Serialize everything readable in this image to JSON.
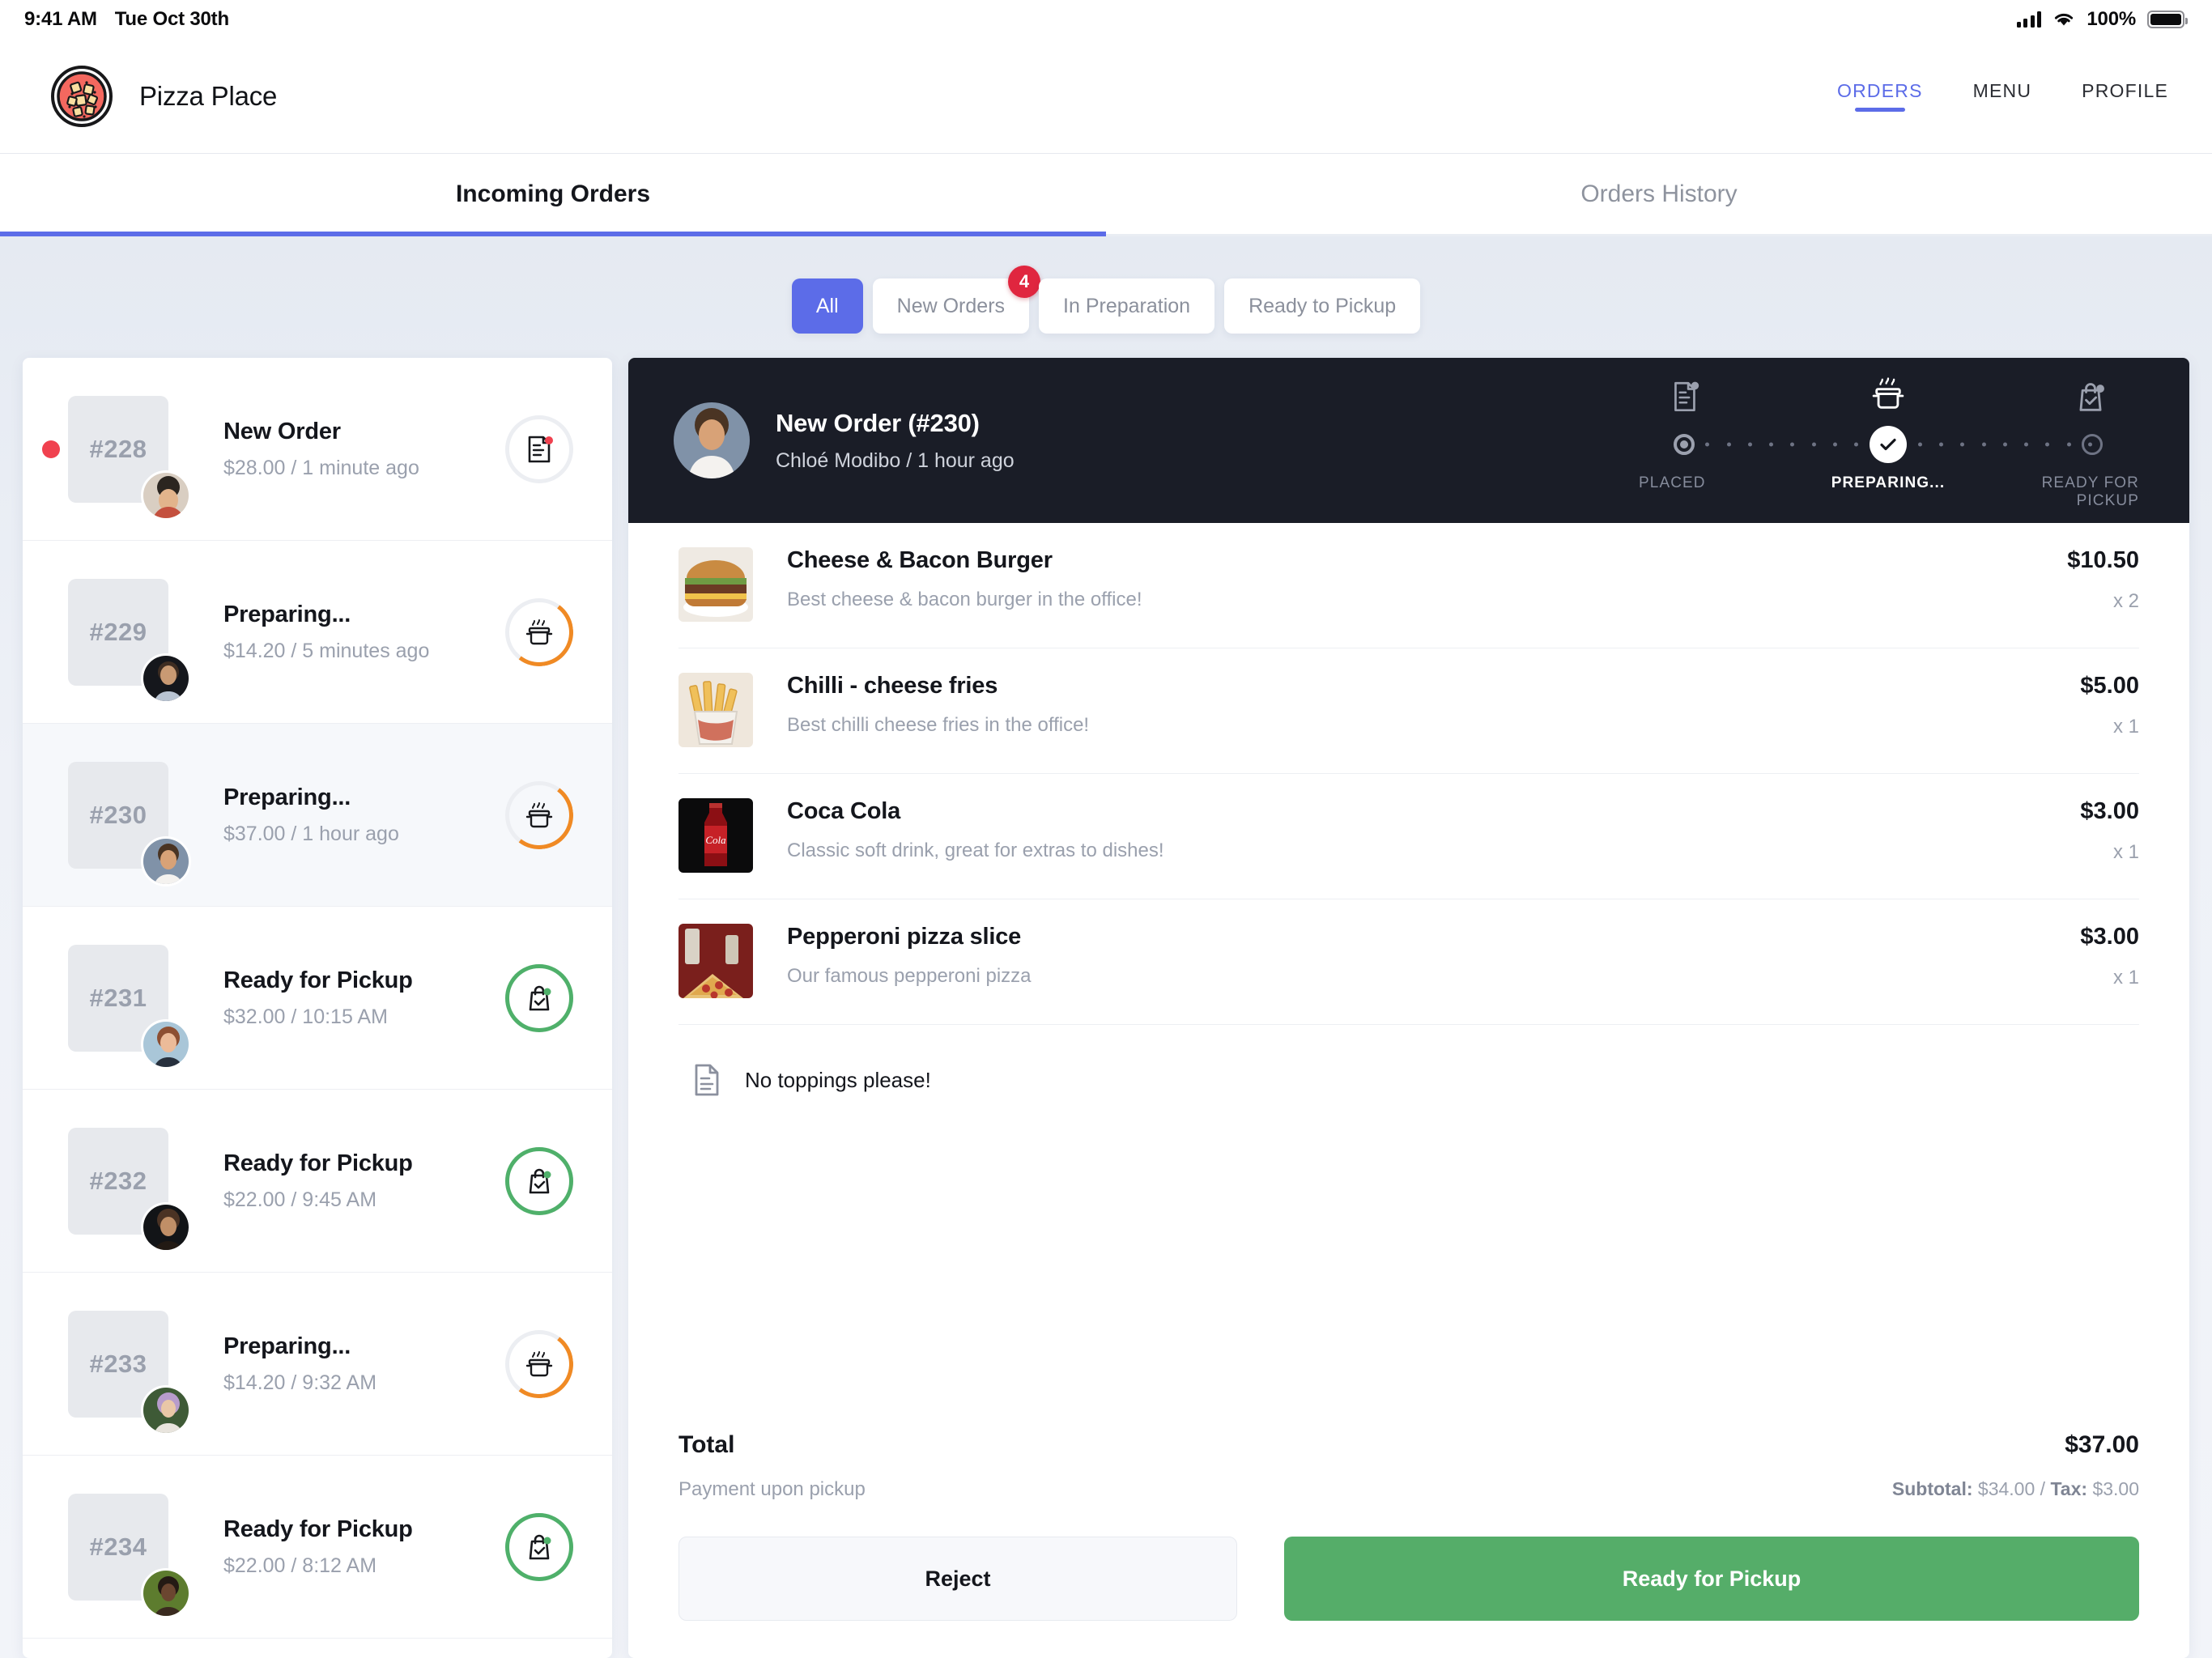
{
  "statusbar": {
    "time": "9:41 AM",
    "date": "Tue Oct 30th",
    "battery": "100%"
  },
  "brand": {
    "name": "Pizza Place"
  },
  "topnav": [
    {
      "label": "ORDERS",
      "active": true
    },
    {
      "label": "MENU",
      "active": false
    },
    {
      "label": "PROFILE",
      "active": false
    }
  ],
  "tabs": [
    {
      "label": "Incoming Orders",
      "active": true
    },
    {
      "label": "Orders History",
      "active": false
    }
  ],
  "filters": [
    {
      "label": "All",
      "active": true,
      "badge": ""
    },
    {
      "label": "New Orders",
      "active": false,
      "badge": "4"
    },
    {
      "label": "In Preparation",
      "active": false,
      "badge": ""
    },
    {
      "label": "Ready to Pickup",
      "active": false,
      "badge": ""
    }
  ],
  "orders": [
    {
      "id": "#228",
      "title": "New Order",
      "sub": "$28.00 / 1 minute ago",
      "state": "new",
      "selected": false,
      "dot": true
    },
    {
      "id": "#229",
      "title": "Preparing...",
      "sub": "$14.20 / 5 minutes ago",
      "state": "preparing",
      "selected": false,
      "dot": false
    },
    {
      "id": "#230",
      "title": "Preparing...",
      "sub": "$37.00 / 1 hour ago",
      "state": "preparing",
      "selected": true,
      "dot": false
    },
    {
      "id": "#231",
      "title": "Ready for Pickup",
      "sub": "$32.00 / 10:15 AM",
      "state": "ready",
      "selected": false,
      "dot": false
    },
    {
      "id": "#232",
      "title": "Ready for Pickup",
      "sub": "$22.00 / 9:45 AM",
      "state": "ready",
      "selected": false,
      "dot": false
    },
    {
      "id": "#233",
      "title": "Preparing...",
      "sub": "$14.20 / 9:32 AM",
      "state": "preparing",
      "selected": false,
      "dot": false
    },
    {
      "id": "#234",
      "title": "Ready for Pickup",
      "sub": "$22.00 / 8:12 AM",
      "state": "ready",
      "selected": false,
      "dot": false
    }
  ],
  "detail": {
    "title": "New Order (#230)",
    "subtitle": "Chloé Modibo / 1 hour ago",
    "steps": [
      {
        "label": "PLACED",
        "state": "done"
      },
      {
        "label": "PREPARING...",
        "state": "current"
      },
      {
        "label": "READY FOR PICKUP",
        "state": "todo"
      }
    ],
    "items": [
      {
        "name": "Cheese & Bacon Burger",
        "desc": "Best cheese & bacon burger in the office!",
        "price": "$10.50",
        "qty": "x 2",
        "img": "burger"
      },
      {
        "name": "Chilli - cheese fries",
        "desc": "Best chilli cheese fries in the office!",
        "price": "$5.00",
        "qty": "x 1",
        "img": "fries"
      },
      {
        "name": "Coca Cola",
        "desc": "Classic soft drink, great for extras to dishes!",
        "price": "$3.00",
        "qty": "x 1",
        "img": "cola"
      },
      {
        "name": "Pepperoni pizza slice",
        "desc": "Our famous pepperoni pizza",
        "price": "$3.00",
        "qty": "x 1",
        "img": "pizza"
      }
    ],
    "note": "No toppings please!",
    "total_label": "Total",
    "total_value": "$37.00",
    "payment_note": "Payment upon pickup",
    "subtotal_label": "Subtotal:",
    "subtotal_value": "$34.00",
    "tax_label": "Tax:",
    "tax_value": "$3.00",
    "reject_label": "Reject",
    "ready_label": "Ready for Pickup"
  },
  "colors": {
    "accent_blue": "#5c6ce8",
    "green": "#55ad69",
    "orange": "#f08a24",
    "red": "#e0263f",
    "dark": "#1a1d27"
  }
}
